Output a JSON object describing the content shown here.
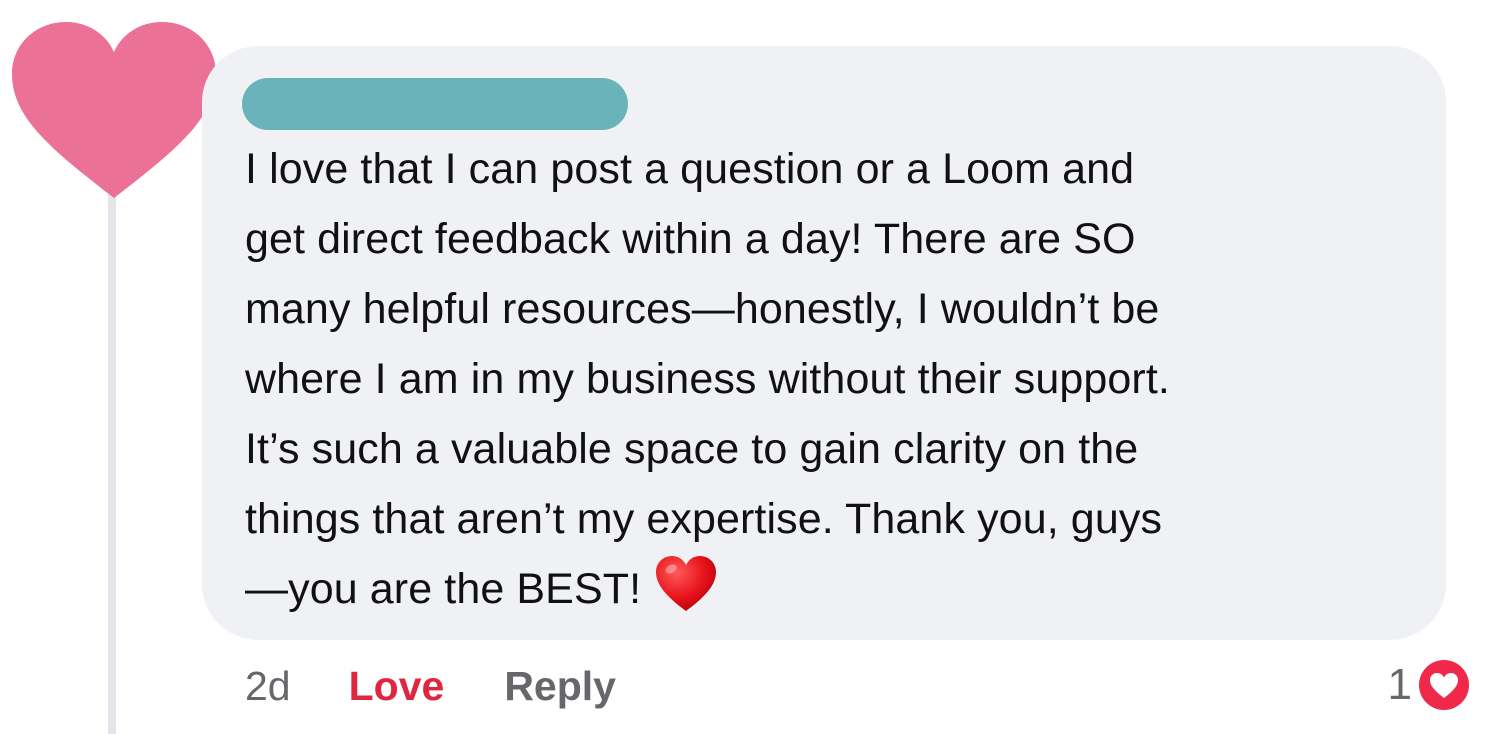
{
  "comment": {
    "author_avatar_icon": "pink-heart-icon",
    "author_avatar_color": "#ec7197",
    "author_name_redaction_color": "#6ab3ba",
    "bubble_color": "#f0f1f5",
    "lines": [
      "I love that I can post a question or a Loom and",
      "get direct feedback within a day! There are SO",
      "many helpful resources—honestly, I wouldn’t be",
      "where I am in my business without their support.",
      "It’s such a valuable space to gain clarity on the",
      "things that aren’t my expertise. Thank you, guys",
      "—you are the BEST!"
    ],
    "trailing_emoji": "red-heart-emoji-icon"
  },
  "actions": {
    "timestamp": "2d",
    "love_label": "Love",
    "love_color": "#e0263f",
    "reply_label": "Reply"
  },
  "reactions": {
    "count": "1",
    "icon": "love-reaction-icon",
    "icon_color": "#f0284a"
  }
}
